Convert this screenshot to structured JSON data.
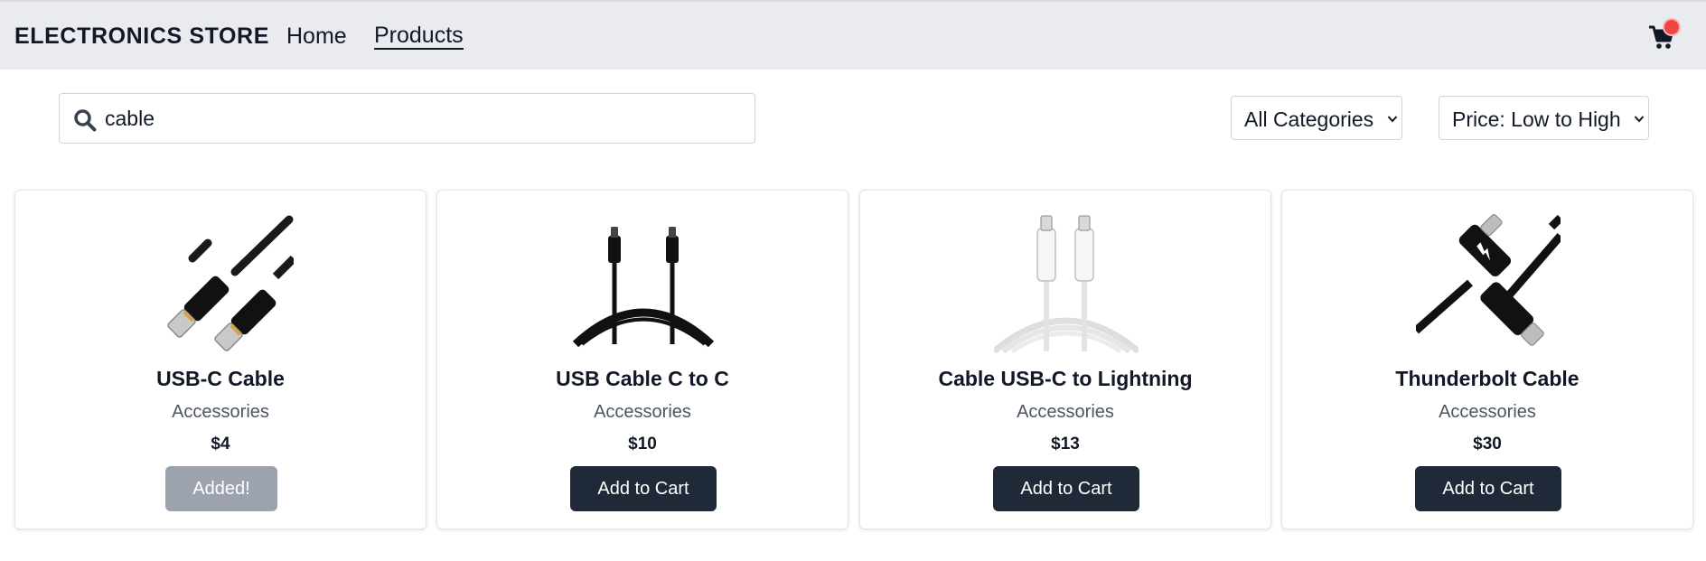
{
  "header": {
    "brand": "ELECTRONICS STORE",
    "nav": [
      {
        "label": "Home"
      },
      {
        "label": "Products",
        "active": true
      }
    ],
    "cart_icon": "shopping-cart-icon",
    "cart_badge_color": "#ef4444"
  },
  "toolbar": {
    "search_icon": "search-icon",
    "search_value": "cable",
    "category_select": {
      "selected": "All Categories"
    },
    "sort_select": {
      "selected": "Price: Low to High"
    }
  },
  "products": [
    {
      "name": "USB-C Cable",
      "category": "Accessories",
      "price": "$4",
      "button": "Added!",
      "image": "usb-c-cable-image"
    },
    {
      "name": "USB Cable C to C",
      "category": "Accessories",
      "price": "$10",
      "button": "Add to Cart",
      "image": "usb-cable-c-to-c-image"
    },
    {
      "name": "Cable USB-C to Lightning",
      "category": "Accessories",
      "price": "$13",
      "button": "Add to Cart",
      "image": "lightning-cable-image"
    },
    {
      "name": "Thunderbolt Cable",
      "category": "Accessories",
      "price": "$30",
      "button": "Add to Cart",
      "image": "thunderbolt-cable-image"
    }
  ],
  "colors": {
    "header_bg": "#e9ebef",
    "button_primary": "#1f2937",
    "button_added": "#9ca3af",
    "muted_text": "#4b5563"
  }
}
